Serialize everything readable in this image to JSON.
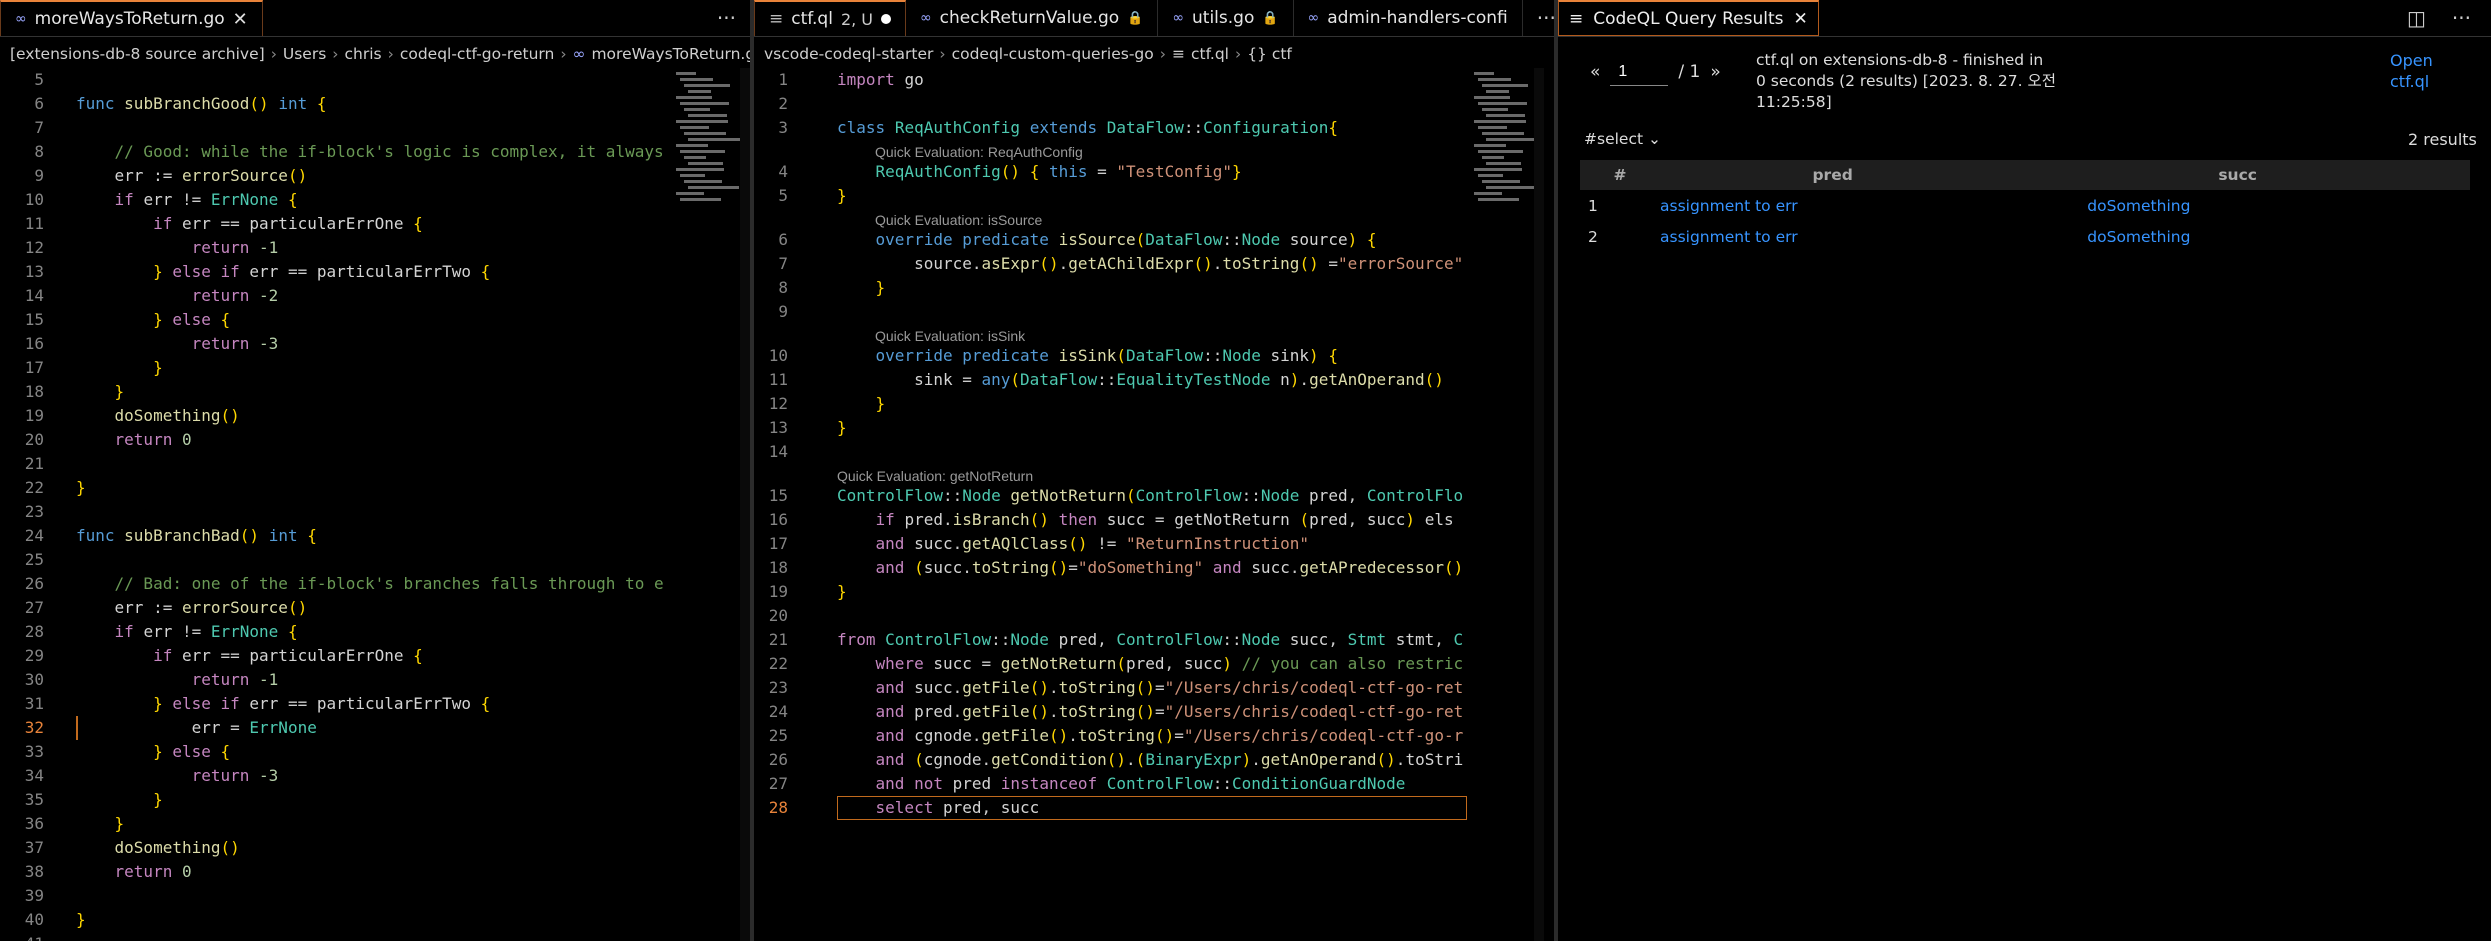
{
  "left": {
    "tab": {
      "label": "moreWaysToReturn.go"
    },
    "breadcrumb": [
      "[extensions-db-8 source archive]",
      "Users",
      "chris",
      "codeql-ctf-go-return",
      "moreWaysToReturn.go"
    ],
    "lines": [
      {
        "n": "5",
        "t": ""
      },
      {
        "n": "6",
        "t": "func subBranchGood() int {"
      },
      {
        "n": "7",
        "t": ""
      },
      {
        "n": "8",
        "t": "    // Good: while the if-block's logic is complex, it always"
      },
      {
        "n": "9",
        "t": "    err := errorSource()"
      },
      {
        "n": "10",
        "t": "    if err != ErrNone {"
      },
      {
        "n": "11",
        "t": "        if err == particularErrOne {"
      },
      {
        "n": "12",
        "t": "            return -1"
      },
      {
        "n": "13",
        "t": "        } else if err == particularErrTwo {"
      },
      {
        "n": "14",
        "t": "            return -2"
      },
      {
        "n": "15",
        "t": "        } else {"
      },
      {
        "n": "16",
        "t": "            return -3"
      },
      {
        "n": "17",
        "t": "        }"
      },
      {
        "n": "18",
        "t": "    }"
      },
      {
        "n": "19",
        "t": "    doSomething()"
      },
      {
        "n": "20",
        "t": "    return 0"
      },
      {
        "n": "21",
        "t": ""
      },
      {
        "n": "22",
        "t": "}"
      },
      {
        "n": "23",
        "t": ""
      },
      {
        "n": "24",
        "t": "func subBranchBad() int {"
      },
      {
        "n": "25",
        "t": ""
      },
      {
        "n": "26",
        "t": "    // Bad: one of the if-block's branches falls through to e"
      },
      {
        "n": "27",
        "t": "    err := errorSource()"
      },
      {
        "n": "28",
        "t": "    if err != ErrNone {"
      },
      {
        "n": "29",
        "t": "        if err == particularErrOne {"
      },
      {
        "n": "30",
        "t": "            return -1"
      },
      {
        "n": "31",
        "t": "        } else if err == particularErrTwo {"
      },
      {
        "n": "32",
        "t": "            err = ErrNone"
      },
      {
        "n": "33",
        "t": "        } else {"
      },
      {
        "n": "34",
        "t": "            return -3"
      },
      {
        "n": "35",
        "t": "        }"
      },
      {
        "n": "36",
        "t": "    }"
      },
      {
        "n": "37",
        "t": "    doSomething()"
      },
      {
        "n": "38",
        "t": "    return 0"
      },
      {
        "n": "39",
        "t": ""
      },
      {
        "n": "40",
        "t": "}"
      },
      {
        "n": "41",
        "t": ""
      }
    ]
  },
  "mid": {
    "tabs": [
      {
        "label": "ctf.ql",
        "badge": "2, U"
      },
      {
        "label": "checkReturnValue.go"
      },
      {
        "label": "utils.go"
      },
      {
        "label": "admin-handlers-confi"
      }
    ],
    "breadcrumb": [
      "vscode-codeql-starter",
      "codeql-custom-queries-go",
      "ctf.ql",
      "{} ctf"
    ],
    "hints": {
      "h4": "Quick Evaluation: ReqAuthConfig",
      "h6": "Quick Evaluation: isSource",
      "h10": "Quick Evaluation: isSink",
      "h15": "Quick Evaluation: getNotReturn"
    },
    "lines": [
      {
        "n": "1",
        "t": "import go"
      },
      {
        "n": "2",
        "t": ""
      },
      {
        "n": "3",
        "t": "class ReqAuthConfig extends DataFlow::Configuration{"
      },
      {
        "n": "4",
        "t": "    ReqAuthConfig() { this = \"TestConfig\"}"
      },
      {
        "n": "5",
        "t": "}"
      },
      {
        "n": "6",
        "t": "    override predicate isSource(DataFlow::Node source) {"
      },
      {
        "n": "7",
        "t": "        source.asExpr().getAChildExpr().toString() =\"errorSource\""
      },
      {
        "n": "8",
        "t": "    }"
      },
      {
        "n": "9",
        "t": ""
      },
      {
        "n": "10",
        "t": "    override predicate isSink(DataFlow::Node sink) {"
      },
      {
        "n": "11",
        "t": "        sink = any(DataFlow::EqualityTestNode n).getAnOperand()"
      },
      {
        "n": "12",
        "t": "    }"
      },
      {
        "n": "13",
        "t": "}"
      },
      {
        "n": "14",
        "t": ""
      },
      {
        "n": "15",
        "t": "ControlFlow::Node getNotReturn(ControlFlow::Node pred, ControlFlo"
      },
      {
        "n": "16",
        "t": "    if pred.isBranch() then succ = getNotReturn (pred, succ) els"
      },
      {
        "n": "17",
        "t": "    and succ.getAQlClass() != \"ReturnInstruction\""
      },
      {
        "n": "18",
        "t": "    and (succ.toString()=\"doSomething\" and succ.getAPredecessor()"
      },
      {
        "n": "19",
        "t": "}"
      },
      {
        "n": "20",
        "t": ""
      },
      {
        "n": "21",
        "t": "from ControlFlow::Node pred, ControlFlow::Node succ, Stmt stmt, C"
      },
      {
        "n": "22",
        "t": "    where succ = getNotReturn(pred, succ) // you can also restric"
      },
      {
        "n": "23",
        "t": "    and succ.getFile().toString()=\"/Users/chris/codeql-ctf-go-ret"
      },
      {
        "n": "24",
        "t": "    and pred.getFile().toString()=\"/Users/chris/codeql-ctf-go-ret"
      },
      {
        "n": "25",
        "t": "    and cgnode.getFile().toString()=\"/Users/chris/codeql-ctf-go-r"
      },
      {
        "n": "26",
        "t": "    and (cgnode.getCondition().(BinaryExpr).getAnOperand().toStri"
      },
      {
        "n": "27",
        "t": "    and not pred instanceof ControlFlow::ConditionGuardNode"
      },
      {
        "n": "28",
        "t": "    select pred, succ"
      }
    ]
  },
  "results": {
    "tab_label": "CodeQL Query Results",
    "page_current": "1",
    "page_total": "/ 1",
    "status": "ctf.ql on extensions-db-8 - finished in 0 seconds (2 results) [2023. 8. 27. 오전 11:25:58]",
    "open_label": "Open ctf.ql",
    "result_set": "#select",
    "count_label": "2 results",
    "columns": [
      "#",
      "pred",
      "succ"
    ],
    "rows": [
      {
        "num": "1",
        "pred": "assignment to err",
        "succ": "doSomething"
      },
      {
        "num": "2",
        "pred": "assignment to err",
        "succ": "doSomething"
      }
    ]
  },
  "colors": {
    "accent": "#e8833a",
    "link": "#3794ff",
    "keyword": "#569cd6",
    "function": "#dcdcaa",
    "type": "#4ec9b0",
    "string": "#ce9178",
    "comment": "#6a9955"
  }
}
